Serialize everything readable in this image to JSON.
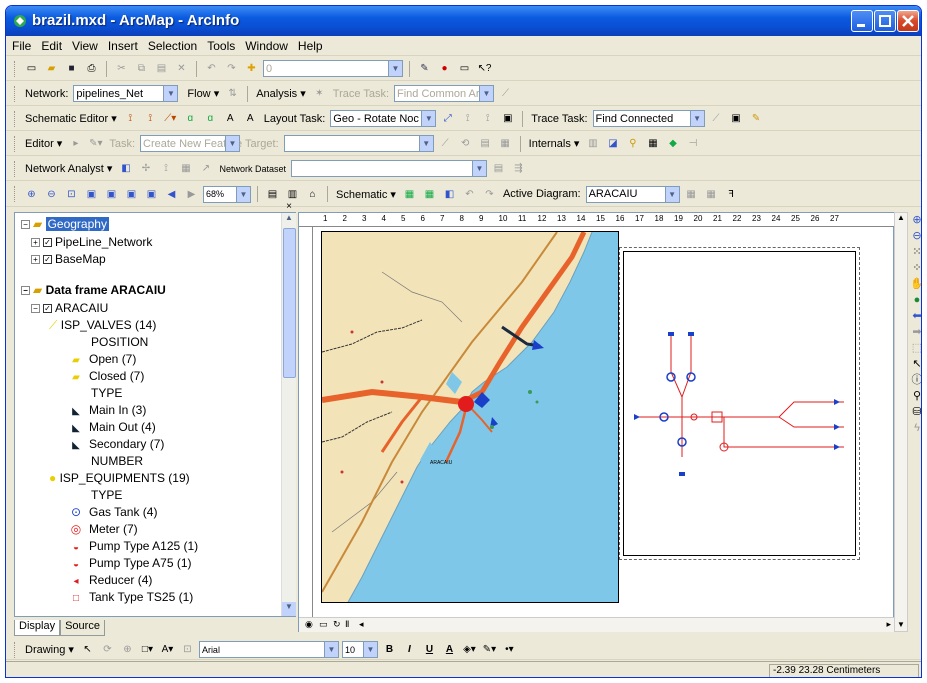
{
  "window": {
    "title": "brazil.mxd - ArcMap - ArcInfo"
  },
  "menu": [
    "File",
    "Edit",
    "View",
    "Insert",
    "Selection",
    "Tools",
    "Window",
    "Help"
  ],
  "standard_toolbar": {
    "scale_value": "0"
  },
  "network_toolbar": {
    "network_label": "Network:",
    "network_value": "pipelines_Net",
    "flow_label": "Flow",
    "analysis_label": "Analysis",
    "trace_task_label": "Trace Task:",
    "trace_task_value": "Find Common Ar"
  },
  "schematic_editor_toolbar": {
    "label": "Schematic Editor",
    "layout_task_label": "Layout Task:",
    "layout_task_value": "Geo - Rotate Noc",
    "trace_task_label": "Trace Task:",
    "trace_task_value": "Find Connected"
  },
  "editor_toolbar": {
    "label": "Editor",
    "task_label": "Task:",
    "task_value": "Create New Feature",
    "target_label": "Target:",
    "internals_label": "Internals"
  },
  "network_analyst_toolbar": {
    "label": "Network Analyst",
    "dataset_label": "Network Dataset"
  },
  "layout_toolbar": {
    "zoom_value": "68%",
    "schematic_label": "Schematic",
    "active_diagram_label": "Active Diagram:",
    "active_diagram_value": "ARACAIU"
  },
  "toc": {
    "geography": {
      "label": "Geography",
      "layers": [
        "PipeLine_Network",
        "BaseMap"
      ]
    },
    "aracaiu_frame": {
      "label": "Data frame ARACAIU",
      "layer": "ARACAIU",
      "isp_valves": {
        "label": "ISP_VALVES  (14)",
        "field1": "POSITION",
        "open": "Open   (7)",
        "closed": "Closed   (7)",
        "field2": "TYPE",
        "main_in": "Main In   (3)",
        "main_out": "Main Out   (4)",
        "secondary": "Secondary   (7)",
        "field3": "NUMBER"
      },
      "isp_equipments": {
        "label": "ISP_EQUIPMENTS  (19)",
        "field1": "TYPE",
        "gas_tank": "Gas Tank   (4)",
        "meter": "Meter   (7)",
        "pump_a125": "Pump Type A125   (1)",
        "pump_a75": "Pump Type A75   (1)",
        "reducer": "Reducer   (4)",
        "tank_ts25": "Tank Type TS25   (1)"
      }
    }
  },
  "tabs": {
    "display": "Display",
    "source": "Source"
  },
  "map": {
    "city_label": "ARACAIU"
  },
  "ruler": [
    "1",
    "2",
    "3",
    "4",
    "5",
    "6",
    "7",
    "8",
    "9",
    "10",
    "11",
    "12",
    "13",
    "14",
    "15",
    "16",
    "17",
    "18",
    "19",
    "20",
    "21",
    "22",
    "23",
    "24",
    "25",
    "26",
    "27"
  ],
  "drawing_toolbar": {
    "label": "Drawing",
    "font": "Arial",
    "font_size": "10",
    "bold": "B",
    "italic": "I",
    "underline": "U",
    "text_a": "A"
  },
  "status": {
    "coordinates": "-2.39  23.28 Centimeters"
  },
  "colors": {
    "titlebar": "#0a4fd4",
    "sea": "#7fc7e8",
    "land": "#f2e4b8",
    "pipe_orange": "#e8622b",
    "pipe_red": "#e21c1c",
    "selection": "#316ac5"
  }
}
